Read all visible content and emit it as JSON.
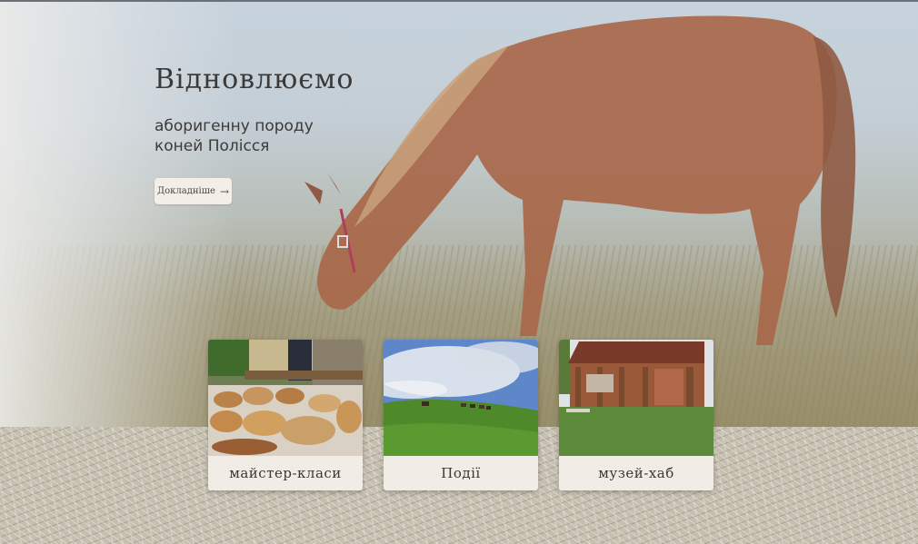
{
  "hero": {
    "title": "Відновлюємо",
    "subtitle_line1": "аборигенну породу",
    "subtitle_line2": "коней Полісся",
    "more_label": "Докладніше",
    "more_arrow": "→"
  },
  "cards": [
    {
      "label": "майстер-класи",
      "image": "bread-and-pastries-photo"
    },
    {
      "label": "Події",
      "image": "horses-on-hill-photo"
    },
    {
      "label": "музей-хаб",
      "image": "wooden-house-photo"
    }
  ],
  "colors": {
    "text_dark": "#3b3a38",
    "card_bg": "#f1ede6",
    "horse": "#a8674a"
  }
}
